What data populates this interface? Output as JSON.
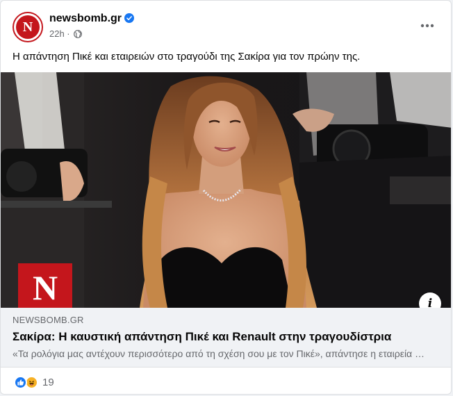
{
  "post": {
    "page_name": "newsbomb.gr",
    "avatar_letter": "N",
    "time": "22h ·",
    "audience_icon": "globe-icon",
    "caption": "Η απάντηση Πικέ και εταιρειών στο τραγούδι της Σακίρα για τον πρώην της."
  },
  "link_preview": {
    "logo_letter": "N",
    "domain": "NEWSBOMB.GR",
    "title": "Σακίρα: Η καυστική απάντηση Πικέ και Renault στην τραγουδίστρια",
    "description": "«Τα ρολόγια μας αντέχουν περισσότερο από τη σχέση σου με τον Πικέ», απάντησε η εταιρεία στη Σακίρα"
  },
  "reactions": {
    "icons": [
      "like-icon",
      "haha-icon"
    ],
    "count": "19"
  },
  "colors": {
    "brand_red": "#c4161c",
    "verified_blue": "#1877f2",
    "text_primary": "#050505",
    "text_secondary": "#65676b",
    "link_bg": "#f0f2f5"
  }
}
